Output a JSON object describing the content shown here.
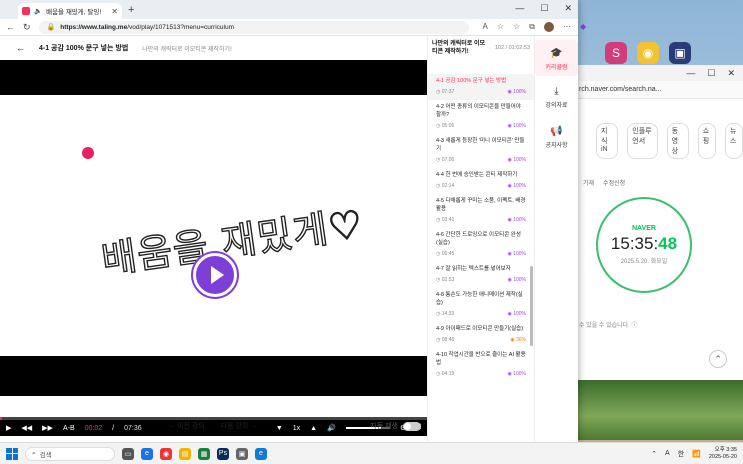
{
  "browser": {
    "tab_title": "배움을 재밌게, 탈잉!",
    "url_host": "https://www.taling.me",
    "url_path": "/vod/play/1071513?menu=curriculum",
    "window_controls": [
      "—",
      "☐",
      "✕"
    ]
  },
  "lesson": {
    "title": "4-1 공감 100% 문구 넣는 방법",
    "course": "나만의 캐릭터로 이모티콘 제작하기!",
    "video_text": "배움을 재밌게♡",
    "current_time": "00:02",
    "total_time": "07:36",
    "speed": "1x",
    "ab_label": "A-B",
    "progress": 0.005,
    "volume": 0.8,
    "prev_label": "이전 강의",
    "next_label": "다음 강의",
    "autoplay_label": "자동 재생"
  },
  "curriculum": {
    "title": "나만의 캐릭터로 이모티콘 제작하기!",
    "count": "102 / 01:02:53",
    "items": [
      {
        "title": "4-1 공감 100% 문구 넣는 방법",
        "duration": "07:37",
        "percent": "100%",
        "active": true
      },
      {
        "title": "4-2 어떤 종류의 이모티콘을 만들어야 할까?",
        "duration": "05:06",
        "percent": "100%"
      },
      {
        "title": "4-3 새롭게 등장한 '미니 이모티콘' 만들기",
        "duration": "07:00",
        "percent": "100%"
      },
      {
        "title": "4-4 한 번에 승인받는 콘티 제작하기",
        "duration": "02:14",
        "percent": "100%"
      },
      {
        "title": "4-5 다채롭게 꾸미는 소품, 이펙트, 배경 활용",
        "duration": "03:41",
        "percent": "100%"
      },
      {
        "title": "4-6 간단한 드로잉으로 이모티콘 완성(실습)",
        "duration": "06:45",
        "percent": "100%"
      },
      {
        "title": "4-7 잘 읽히는 텍스트를 넣어보자",
        "duration": "02:53",
        "percent": "100%"
      },
      {
        "title": "4-8 통손도 가능한 애니메이션 제작(실습)",
        "duration": "14:33",
        "percent": "100%"
      },
      {
        "title": "4-9 아이패드로 이모티콘 만들기(실습)",
        "duration": "08:46",
        "percent": "36%",
        "low": true
      },
      {
        "title": "4-10 작업시간을 반으로 줄이는 AI 활용법",
        "duration": "04:19",
        "percent": "100%"
      }
    ]
  },
  "side_menu": [
    {
      "label": "커리큘럼",
      "icon": "graduation-cap-icon",
      "active": true
    },
    {
      "label": "강의자료",
      "icon": "download-icon"
    },
    {
      "label": "공지사항",
      "icon": "megaphone-icon"
    }
  ],
  "background_window": {
    "url": "rch.naver.com/search.na...",
    "tabs": [
      "지식iN",
      "인플루언서",
      "동영상",
      "쇼핑",
      "뉴스"
    ],
    "sub": [
      "기재",
      "수정신청"
    ],
    "clock_brand": "NAVER",
    "clock_hm": "15:35:",
    "clock_sec": "48",
    "clock_date": "2025.5.20. 화요일",
    "note": "수 있을 수 있습니다. ⓘ"
  },
  "taskbar": {
    "search_placeholder": "검색",
    "time": "오후 3:35",
    "date": "2025-05-20",
    "tray_a": "A",
    "tray_lang": "한"
  },
  "colors": {
    "accent": "#ff2d55",
    "purple": "#7e3fd6",
    "naver": "#03c75a"
  }
}
